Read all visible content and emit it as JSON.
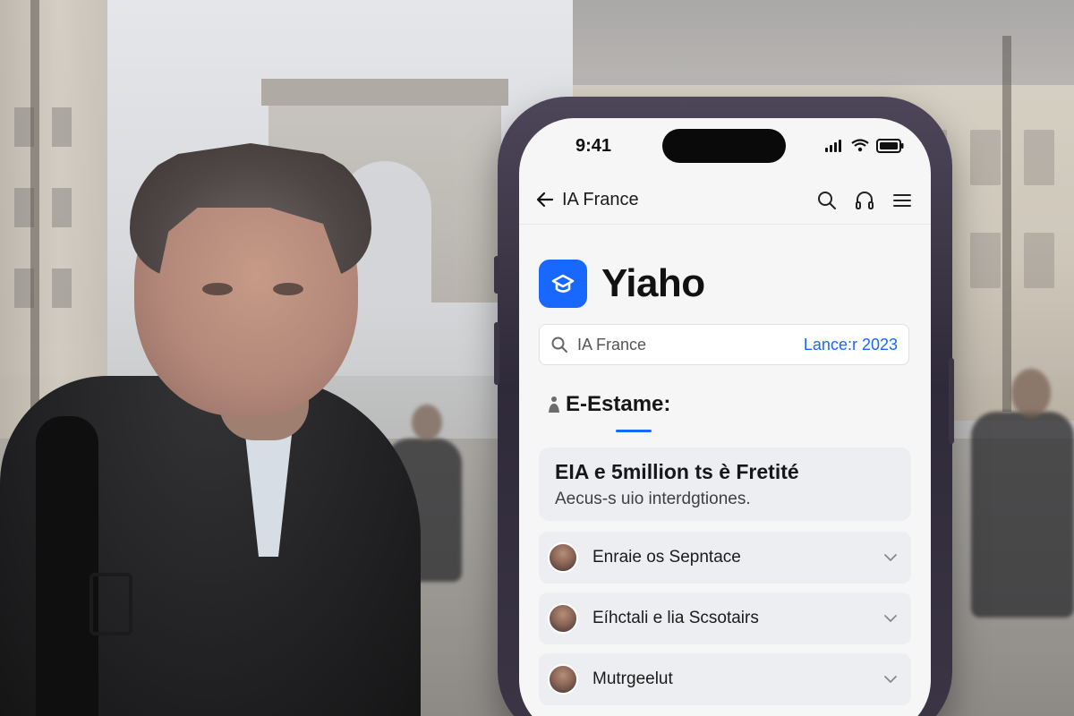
{
  "phone": {
    "status_bar": {
      "time": "9:41"
    },
    "header": {
      "back_label": "IA France",
      "actions": [
        "search-icon",
        "headphones-icon",
        "menu-icon"
      ]
    },
    "brand": {
      "name": "Yiaho",
      "accent_color": "#1867ff"
    },
    "search": {
      "query": "IA France",
      "meta": "Lance:r 2023"
    },
    "section": {
      "title": "E-Estame:"
    },
    "summary_card": {
      "headline": "EIA e 5million ts è Fretité",
      "subtext": "Aecus-s uio interdgtiones."
    },
    "accordion": [
      {
        "label": "Enraie os Sepntace",
        "icon": "chevron-down-icon"
      },
      {
        "label": "Eíhctali e  lia Scsotairs",
        "icon": "chevron-down-icon"
      },
      {
        "label": "Mutrgeelut",
        "icon": "chevron-down-icon"
      }
    ]
  }
}
